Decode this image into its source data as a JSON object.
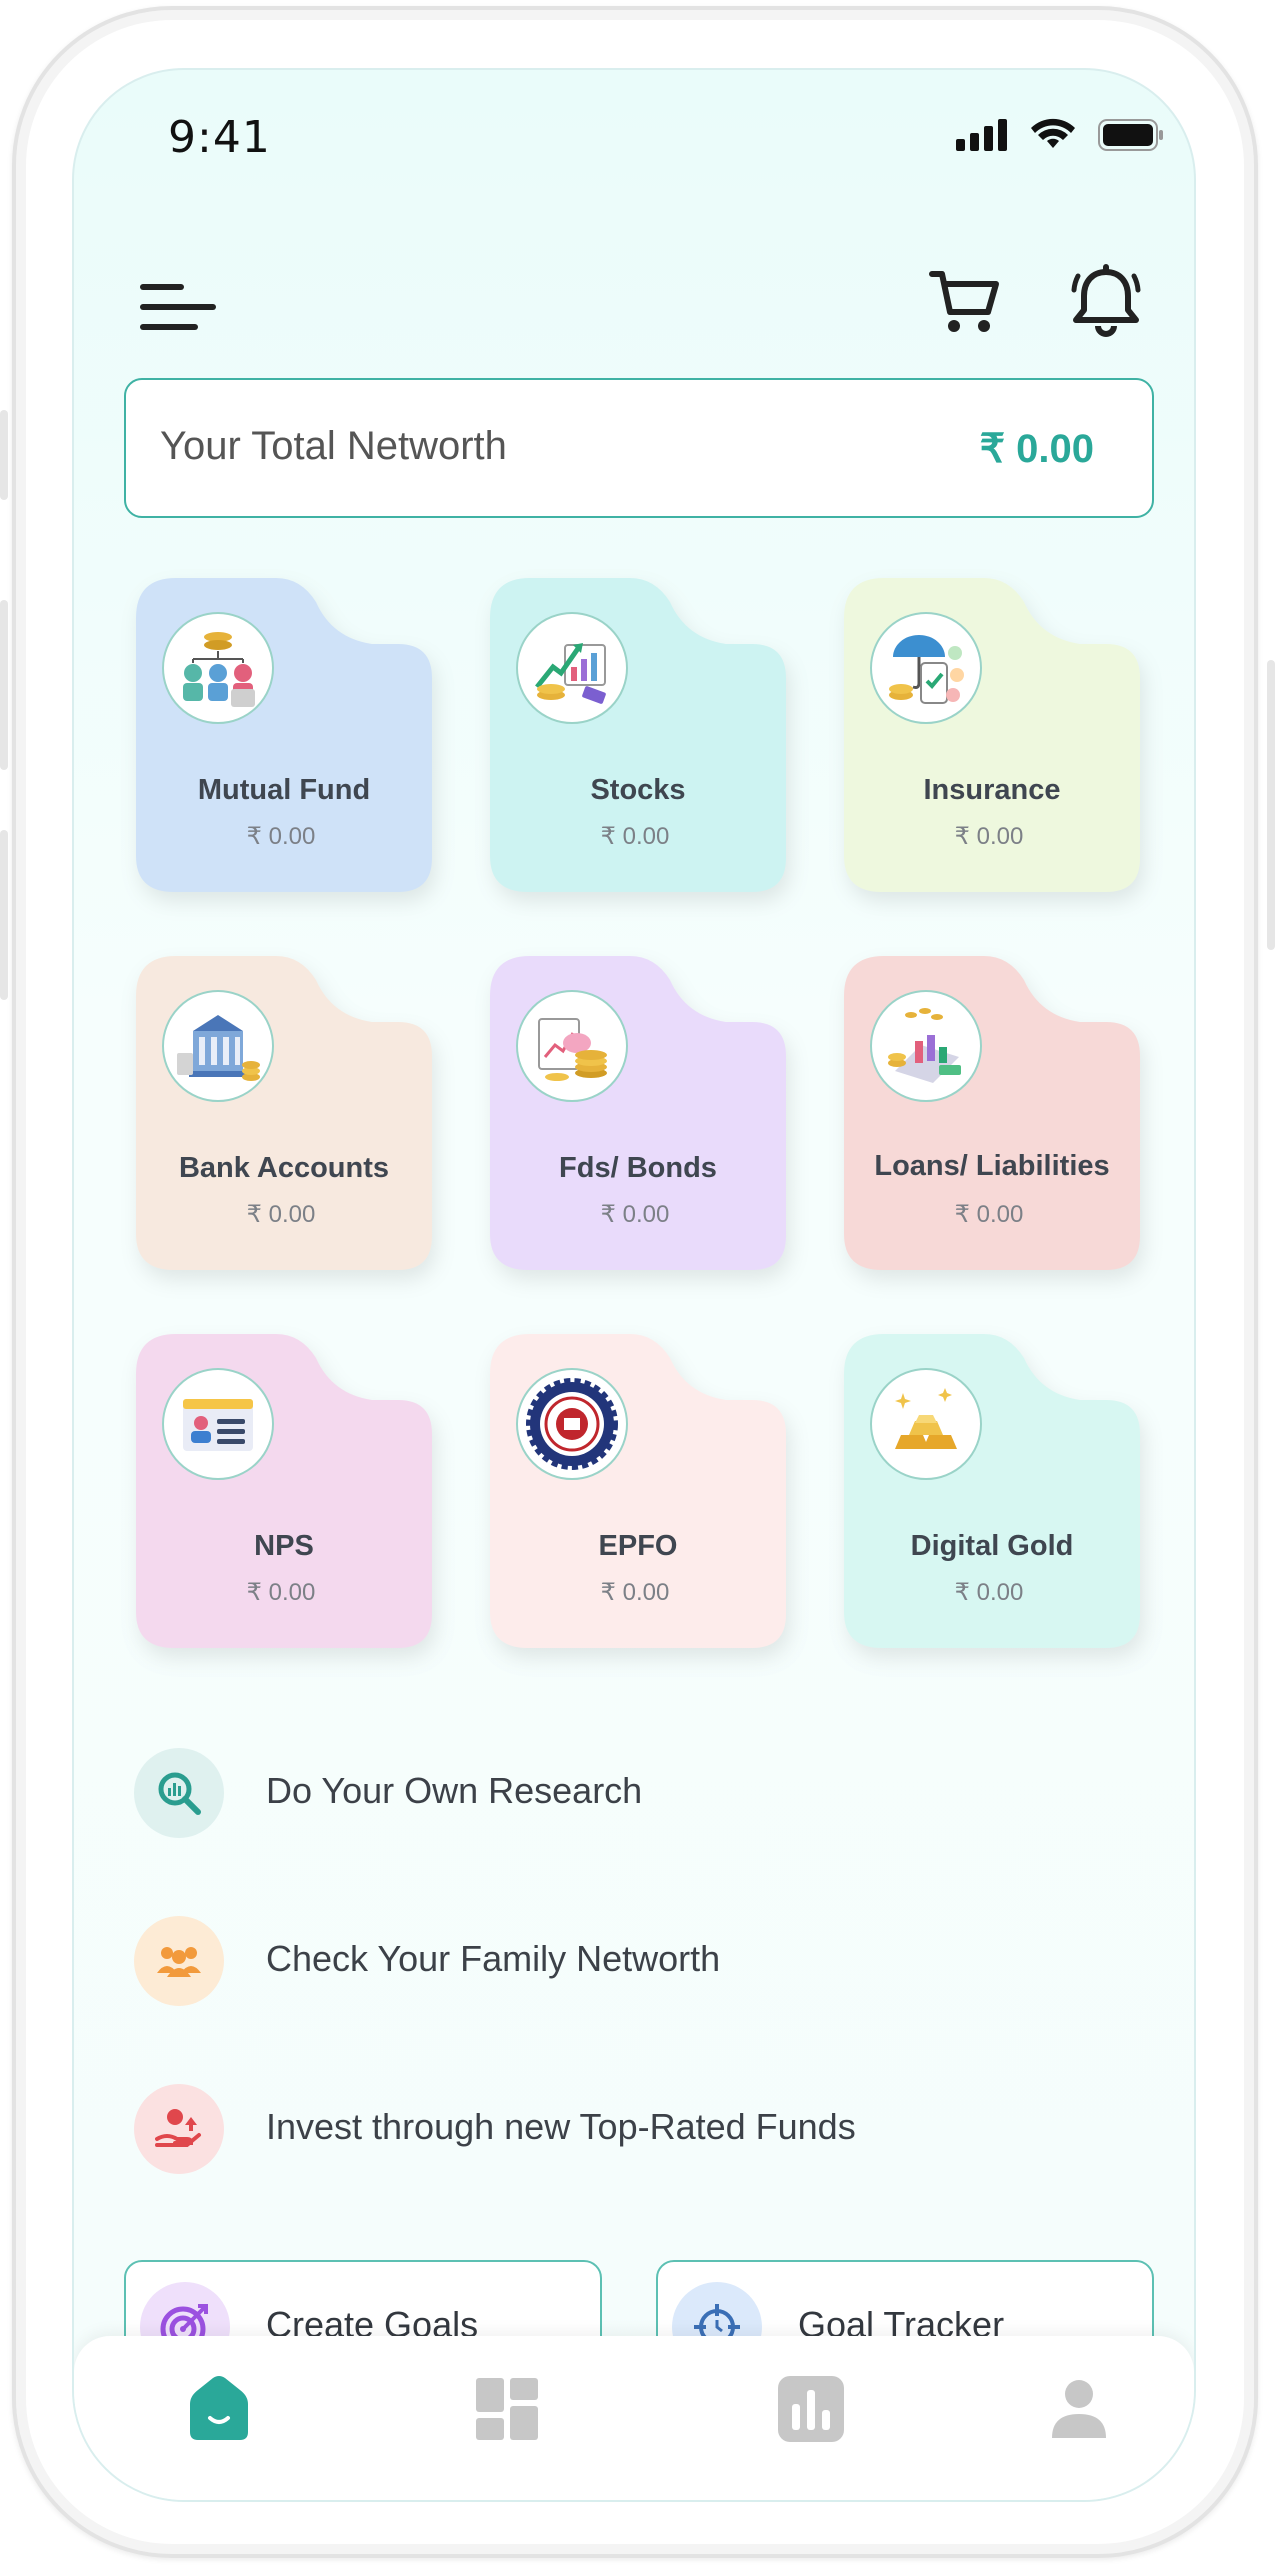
{
  "status_bar": {
    "time": "9:41"
  },
  "networth": {
    "label": "Your Total Networth",
    "value": "₹ 0.00"
  },
  "assets": [
    {
      "name": "Mutual Fund",
      "value": "₹ 0.00",
      "color": "#cfe2f8",
      "icon": "mutual-fund-icon"
    },
    {
      "name": "Stocks",
      "value": "₹ 0.00",
      "color": "#cdf3f2",
      "icon": "stocks-icon"
    },
    {
      "name": "Insurance",
      "value": "₹ 0.00",
      "color": "#eef8de",
      "icon": "insurance-icon"
    },
    {
      "name": "Bank Accounts",
      "value": "₹ 0.00",
      "color": "#f7e9df",
      "icon": "bank-icon"
    },
    {
      "name": "Fds/ Bonds",
      "value": "₹ 0.00",
      "color": "#e9dbfb",
      "icon": "fds-bonds-icon"
    },
    {
      "name": "Loans/ Liabilities",
      "value": "₹ 0.00",
      "color": "#f7d9d7",
      "icon": "loans-icon"
    },
    {
      "name": "NPS",
      "value": "₹ 0.00",
      "color": "#f4d9ee",
      "icon": "nps-icon"
    },
    {
      "name": "EPFO",
      "value": "₹ 0.00",
      "color": "#fdeceb",
      "icon": "epfo-icon"
    },
    {
      "name": "Digital Gold",
      "value": "₹ 0.00",
      "color": "#d7f7f2",
      "icon": "gold-icon"
    }
  ],
  "actions": [
    {
      "label": "Do Your Own Research",
      "icon": "research-icon",
      "bg": "#dff1ef",
      "fg": "#2a9d8f"
    },
    {
      "label": "Check Your Family Networth",
      "icon": "family-icon",
      "bg": "#fdebd5",
      "fg": "#f29a3c"
    },
    {
      "label": "Invest through new Top-Rated Funds",
      "icon": "invest-hand-icon",
      "bg": "#fbe1e1",
      "fg": "#e0474c"
    }
  ],
  "goals": [
    {
      "label": "Create Goals",
      "icon": "target-icon",
      "bg": "#efe0fb",
      "fg": "#9b51e0"
    },
    {
      "label": "Goal Tracker",
      "icon": "tracker-icon",
      "bg": "#dbe9fb",
      "fg": "#3b6fb6"
    }
  ],
  "nav": [
    {
      "icon": "home-icon",
      "active": true
    },
    {
      "icon": "dashboard-icon",
      "active": false
    },
    {
      "icon": "analytics-icon",
      "active": false
    },
    {
      "icon": "profile-icon",
      "active": false
    }
  ],
  "colors": {
    "accent": "#2aa899",
    "inactive_nav": "#c7c7c7"
  }
}
